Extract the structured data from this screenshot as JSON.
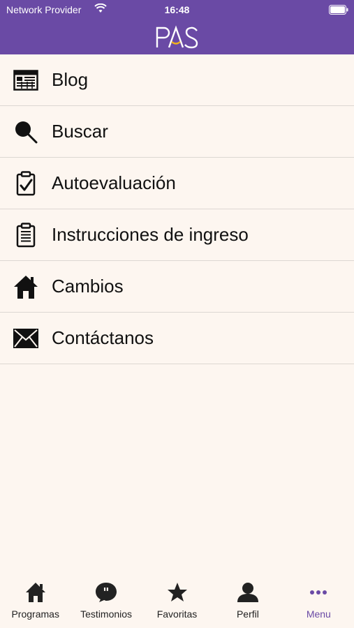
{
  "status_bar": {
    "carrier": "Network Provider",
    "time": "16:48"
  },
  "header": {
    "logo_text": "PAS"
  },
  "menu": {
    "items": [
      {
        "label": "Blog",
        "icon": "newspaper-icon"
      },
      {
        "label": "Buscar",
        "icon": "search-icon"
      },
      {
        "label": "Autoevaluación",
        "icon": "clipboard-check-icon"
      },
      {
        "label": "Instrucciones de ingreso",
        "icon": "clipboard-list-icon"
      },
      {
        "label": "Cambios",
        "icon": "home-icon"
      },
      {
        "label": "Contáctanos",
        "icon": "envelope-icon"
      }
    ]
  },
  "tab_bar": {
    "tabs": [
      {
        "label": "Programas",
        "icon": "home-icon"
      },
      {
        "label": "Testimonios",
        "icon": "quote-bubble-icon"
      },
      {
        "label": "Favoritas",
        "icon": "star-icon"
      },
      {
        "label": "Perfil",
        "icon": "user-icon"
      },
      {
        "label": "Menu",
        "icon": "more-dots-icon",
        "active": true
      }
    ]
  },
  "colors": {
    "brand": "#6a4aa5",
    "background": "#fdf6f0",
    "logo_accent": "#f2b31b"
  }
}
